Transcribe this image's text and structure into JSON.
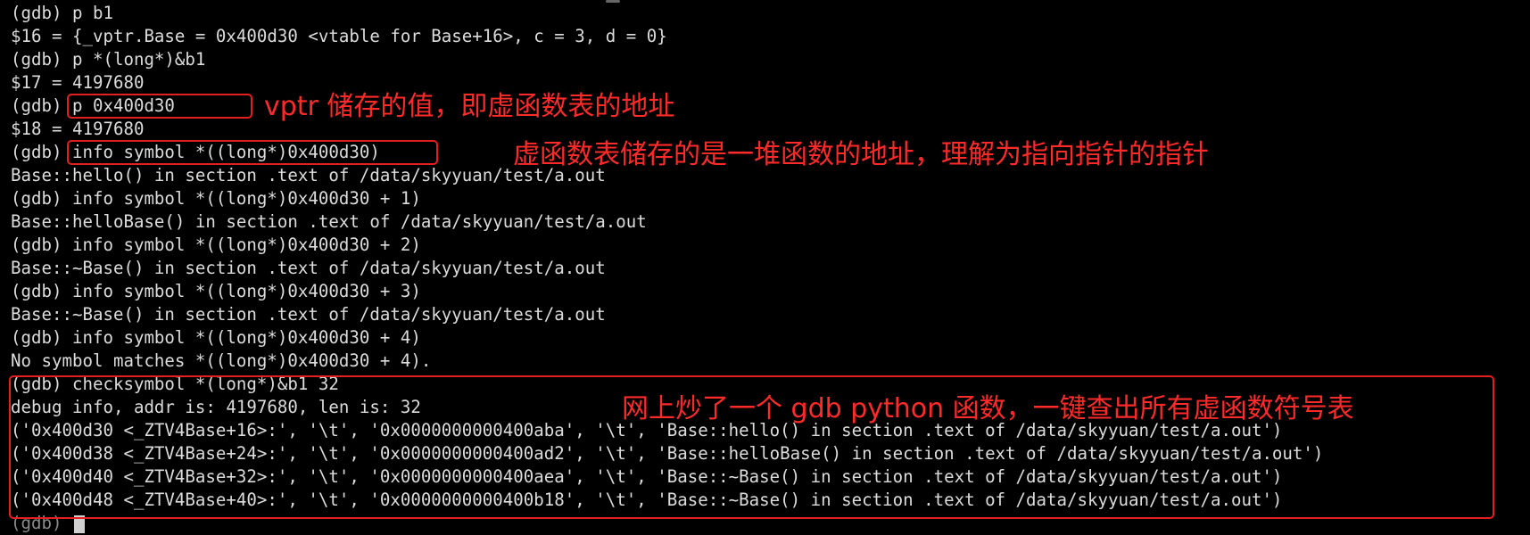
{
  "colors": {
    "background": "#000000",
    "terminal_text": "#dcdcdc",
    "annotation_red": "#e41f1f"
  },
  "terminal": {
    "lines": [
      "(gdb) p b1",
      "$16 = {_vptr.Base = 0x400d30 <vtable for Base+16>, c = 3, d = 0}",
      "(gdb) p *(long*)&b1",
      "$17 = 4197680",
      "(gdb) p 0x400d30",
      "$18 = 4197680",
      "(gdb) info symbol *((long*)0x400d30)",
      "Base::hello() in section .text of /data/skyyuan/test/a.out",
      "(gdb) info symbol *((long*)0x400d30 + 1)",
      "Base::helloBase() in section .text of /data/skyyuan/test/a.out",
      "(gdb) info symbol *((long*)0x400d30 + 2)",
      "Base::~Base() in section .text of /data/skyyuan/test/a.out",
      "(gdb) info symbol *((long*)0x400d30 + 3)",
      "Base::~Base() in section .text of /data/skyyuan/test/a.out",
      "(gdb) info symbol *((long*)0x400d30 + 4)",
      "No symbol matches *((long*)0x400d30 + 4).",
      "(gdb) checksymbol *(long*)&b1 32",
      "debug info, addr is: 4197680, len is: 32",
      "('0x400d30 <_ZTV4Base+16>:', '\\t', '0x0000000000400aba', '\\t', 'Base::hello() in section .text of /data/skyyuan/test/a.out')",
      "('0x400d38 <_ZTV4Base+24>:', '\\t', '0x0000000000400ad2', '\\t', 'Base::helloBase() in section .text of /data/skyyuan/test/a.out')",
      "('0x400d40 <_ZTV4Base+32>:', '\\t', '0x0000000000400aea', '\\t', 'Base::~Base() in section .text of /data/skyyuan/test/a.out')",
      "('0x400d48 <_ZTV4Base+40>:', '\\t', '0x0000000000400b18', '\\t', 'Base::~Base() in section .text of /data/skyyuan/test/a.out')"
    ],
    "prompt": "(gdb)"
  },
  "annotations": {
    "vptr_value": "vptr 储存的值，即虚函数表的地址",
    "vtable_contents": "虚函数表储存的是一堆函数的地址，理解为指向指针的指针",
    "gdb_python": "网上炒了一个 gdb python 函数，一键查出所有虚函数符号表"
  }
}
